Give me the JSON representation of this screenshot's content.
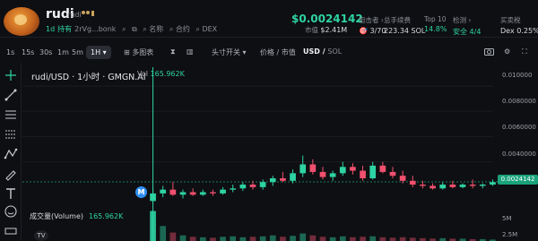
{
  "header": {
    "name": "rudi",
    "symbol": "rudi",
    "age": "1d",
    "hold_label": "持有",
    "address": "2rVg...bonk",
    "price": "$0.0024142",
    "mcap_label": "市值",
    "mcap": "$2.41M",
    "stats": [
      {
        "label": "狙击者 ›",
        "value": "3/70"
      },
      {
        "label": "总手续费",
        "value": "223.34 SOL"
      },
      {
        "label": "Top 10",
        "value": "14.8%"
      },
      {
        "label": "检测 ›",
        "value": "安全 4/4"
      },
      {
        "label": "买卖税",
        "value": "Dex 0.25%"
      }
    ],
    "links": [
      "名称",
      "合约",
      "DEX"
    ]
  },
  "toolbar": {
    "timeframes": [
      "1s",
      "15s",
      "30s",
      "1m",
      "5m",
      "1H"
    ],
    "selected_timeframe": "1H",
    "indicators_label": "多图表",
    "flip_label": "头寸开关",
    "price_mcap_label": "价格",
    "mcap_label": "市值",
    "currency": "USD",
    "alt_currency": "SOL"
  },
  "chart_legend": {
    "title": "rudi/USD · 1小时 · GMGN.AI",
    "vol_label": "Vol",
    "vol_value": "165.962K",
    "volume_label": "成交量(Volume)",
    "volume_value": "165.962K",
    "current_price_tag": "0.0024142",
    "marker_letter": "M",
    "tv_logo_text": "TV"
  },
  "chart_data": {
    "type": "candlestick",
    "y_axis_ticks": [
      "0.010000",
      "0.0080000",
      "0.0060000",
      "0.0040000"
    ],
    "volume_axis_ticks": [
      "5M",
      "2.5M"
    ],
    "ylim": [
      0.0005,
      0.011
    ],
    "last_price": 0.0024142,
    "candles": [
      {
        "o": 0.0009,
        "h": 0.002,
        "l": 0.0007,
        "c": 0.0015
      },
      {
        "o": 0.0015,
        "h": 0.0021,
        "l": 0.0012,
        "c": 0.0018
      },
      {
        "o": 0.0018,
        "h": 0.0024,
        "l": 0.0013,
        "c": 0.0014
      },
      {
        "o": 0.0014,
        "h": 0.0018,
        "l": 0.0011,
        "c": 0.0016
      },
      {
        "o": 0.0016,
        "h": 0.0019,
        "l": 0.0013,
        "c": 0.0014
      },
      {
        "o": 0.0014,
        "h": 0.0018,
        "l": 0.0013,
        "c": 0.0016
      },
      {
        "o": 0.0016,
        "h": 0.0018,
        "l": 0.0013,
        "c": 0.0015
      },
      {
        "o": 0.0015,
        "h": 0.002,
        "l": 0.0014,
        "c": 0.0018
      },
      {
        "o": 0.0018,
        "h": 0.0022,
        "l": 0.0016,
        "c": 0.0019
      },
      {
        "o": 0.0019,
        "h": 0.0024,
        "l": 0.0017,
        "c": 0.0022
      },
      {
        "o": 0.0022,
        "h": 0.0025,
        "l": 0.0018,
        "c": 0.002
      },
      {
        "o": 0.002,
        "h": 0.0026,
        "l": 0.0018,
        "c": 0.0024
      },
      {
        "o": 0.0024,
        "h": 0.0029,
        "l": 0.0021,
        "c": 0.0027
      },
      {
        "o": 0.0027,
        "h": 0.0032,
        "l": 0.0024,
        "c": 0.0025
      },
      {
        "o": 0.0025,
        "h": 0.0034,
        "l": 0.0023,
        "c": 0.0031
      },
      {
        "o": 0.0031,
        "h": 0.0045,
        "l": 0.0028,
        "c": 0.0038
      },
      {
        "o": 0.0038,
        "h": 0.0042,
        "l": 0.003,
        "c": 0.0032
      },
      {
        "o": 0.0032,
        "h": 0.0036,
        "l": 0.0026,
        "c": 0.0028
      },
      {
        "o": 0.0028,
        "h": 0.0033,
        "l": 0.0025,
        "c": 0.0031
      },
      {
        "o": 0.0031,
        "h": 0.004,
        "l": 0.0029,
        "c": 0.0036
      },
      {
        "o": 0.0036,
        "h": 0.0039,
        "l": 0.003,
        "c": 0.0033
      },
      {
        "o": 0.0033,
        "h": 0.0037,
        "l": 0.0025,
        "c": 0.0027
      },
      {
        "o": 0.0027,
        "h": 0.004,
        "l": 0.0026,
        "c": 0.0037
      },
      {
        "o": 0.0037,
        "h": 0.004,
        "l": 0.0031,
        "c": 0.0032
      },
      {
        "o": 0.0032,
        "h": 0.0036,
        "l": 0.0027,
        "c": 0.0029
      },
      {
        "o": 0.0029,
        "h": 0.0033,
        "l": 0.0023,
        "c": 0.0025
      },
      {
        "o": 0.0025,
        "h": 0.0029,
        "l": 0.002,
        "c": 0.0022
      },
      {
        "o": 0.0022,
        "h": 0.0025,
        "l": 0.0019,
        "c": 0.0021
      },
      {
        "o": 0.0021,
        "h": 0.0023,
        "l": 0.0018,
        "c": 0.0019
      },
      {
        "o": 0.0019,
        "h": 0.0024,
        "l": 0.0018,
        "c": 0.0022
      },
      {
        "o": 0.0022,
        "h": 0.0025,
        "l": 0.0019,
        "c": 0.002
      },
      {
        "o": 0.002,
        "h": 0.0023,
        "l": 0.0019,
        "c": 0.0022
      },
      {
        "o": 0.0022,
        "h": 0.0026,
        "l": 0.0019,
        "c": 0.0021
      },
      {
        "o": 0.0021,
        "h": 0.0023,
        "l": 0.0019,
        "c": 0.0022
      },
      {
        "o": 0.0022,
        "h": 0.0026,
        "l": 0.0021,
        "c": 0.0024
      }
    ],
    "volumes_millions": [
      6.4,
      3.2,
      1.8,
      1.2,
      0.9,
      0.8,
      0.7,
      0.9,
      1.0,
      0.8,
      0.9,
      1.0,
      1.2,
      0.9,
      1.1,
      1.6,
      1.2,
      0.9,
      0.8,
      1.0,
      0.8,
      0.9,
      1.0,
      0.8,
      0.7,
      0.8,
      0.7,
      0.6,
      0.5,
      0.6,
      0.5,
      0.5,
      0.4,
      0.4,
      0.3
    ],
    "colors": {
      "up": "#2ed3a3",
      "down": "#f0506e",
      "highlight": "#2ed3a3"
    }
  }
}
